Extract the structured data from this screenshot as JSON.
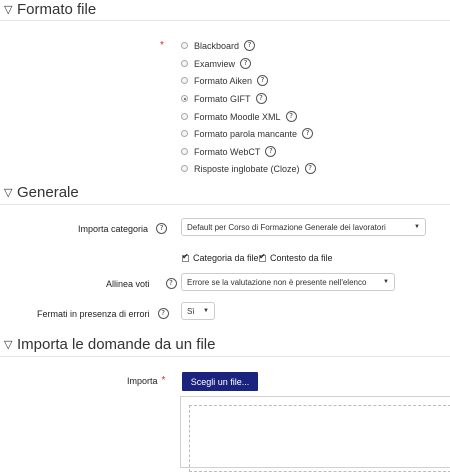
{
  "sections": {
    "file_format": {
      "chevron": "▽",
      "title": "Formato file"
    },
    "general": {
      "chevron": "▽",
      "title": "Generale"
    },
    "import": {
      "chevron": "▽",
      "title": "Importa le domande da un file"
    }
  },
  "file_format": {
    "required_marker": "*",
    "options": [
      {
        "label": "Blackboard",
        "selected": false
      },
      {
        "label": "Examview",
        "selected": false
      },
      {
        "label": "Formato Aiken",
        "selected": false
      },
      {
        "label": "Formato GIFT",
        "selected": true
      },
      {
        "label": "Formato Moodle XML",
        "selected": false
      },
      {
        "label": "Formato parola mancante",
        "selected": false
      },
      {
        "label": "Formato WebCT",
        "selected": false
      },
      {
        "label": "Risposte inglobate (Cloze)",
        "selected": false
      }
    ]
  },
  "general": {
    "import_category_label": "Importa categoria",
    "import_category_value": "Default per Corso di Formazione Generale dei lavoratori",
    "category_from_file_label": "Categoria da file",
    "context_from_file_label": "Contesto da file",
    "match_grades_label": "Allinea voti",
    "match_grades_value": "Errore se la valutazione non è presente nell'elenco",
    "stop_on_error_label": "Fermati in presenza di errori",
    "stop_on_error_value": "Sì"
  },
  "import": {
    "label": "Importa",
    "required_marker": "*",
    "choose_file_button": "Scegli un file..."
  },
  "icons": {
    "help": "?",
    "caret": "▼"
  }
}
